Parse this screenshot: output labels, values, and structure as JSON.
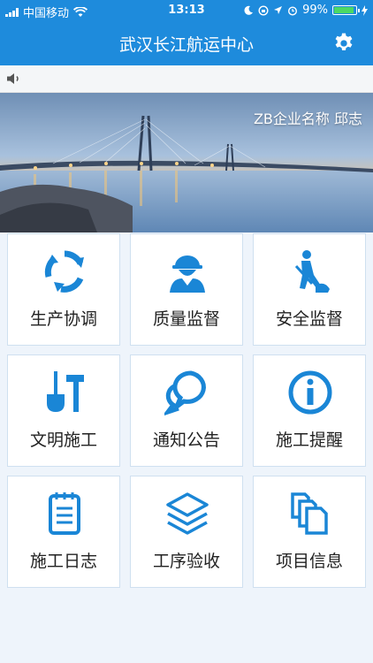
{
  "status": {
    "carrier": "中国移动",
    "time": "13:13",
    "battery": "99%"
  },
  "header": {
    "title": "武汉长江航运中心",
    "settings_icon": "gear-icon"
  },
  "notice": {
    "icon": "speaker-icon"
  },
  "banner": {
    "company": "ZB企业名称 邱志"
  },
  "menu": [
    {
      "label": "生产协调",
      "icon": "recycle-icon"
    },
    {
      "label": "质量监督",
      "icon": "worker-icon"
    },
    {
      "label": "安全监督",
      "icon": "digging-worker-icon"
    },
    {
      "label": "文明施工",
      "icon": "tools-icon"
    },
    {
      "label": "通知公告",
      "icon": "chat-bubbles-icon"
    },
    {
      "label": "施工提醒",
      "icon": "info-icon"
    },
    {
      "label": "施工日志",
      "icon": "notepad-icon"
    },
    {
      "label": "工序验收",
      "icon": "layers-icon"
    },
    {
      "label": "项目信息",
      "icon": "documents-icon"
    }
  ],
  "colors": {
    "primary": "#1e8bdc",
    "icon": "#1a86d6"
  }
}
